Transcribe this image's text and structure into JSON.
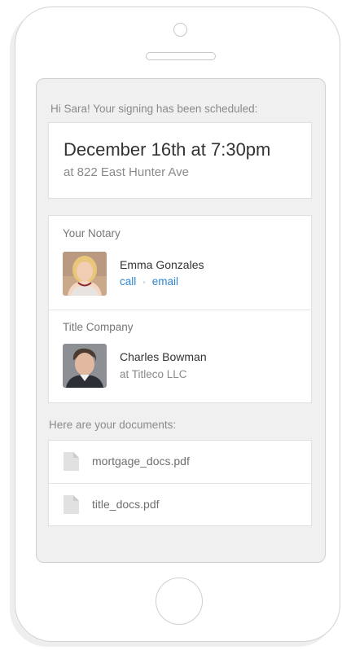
{
  "greeting": "Hi Sara! Your signing has been scheduled:",
  "appointment": {
    "datetime": "December 16th at 7:30pm",
    "address": "at 822 East Hunter Ave"
  },
  "notary": {
    "section_title": "Your Notary",
    "name": "Emma Gonzales",
    "call_label": "call",
    "separator": "•",
    "email_label": "email"
  },
  "title_company": {
    "section_title": "Title Company",
    "name": "Charles Bowman",
    "company": "at Titleco LLC"
  },
  "documents": {
    "heading": "Here are your documents:",
    "items": [
      {
        "name": "mortgage_docs.pdf",
        "icon": "document-icon"
      },
      {
        "name": "title_docs.pdf",
        "icon": "document-icon"
      }
    ]
  },
  "colors": {
    "link": "#2f86cf",
    "screen_background": "#f0f0f0",
    "card_background": "#ffffff",
    "primary_text": "#333333",
    "secondary_text": "#8a8a8a"
  }
}
